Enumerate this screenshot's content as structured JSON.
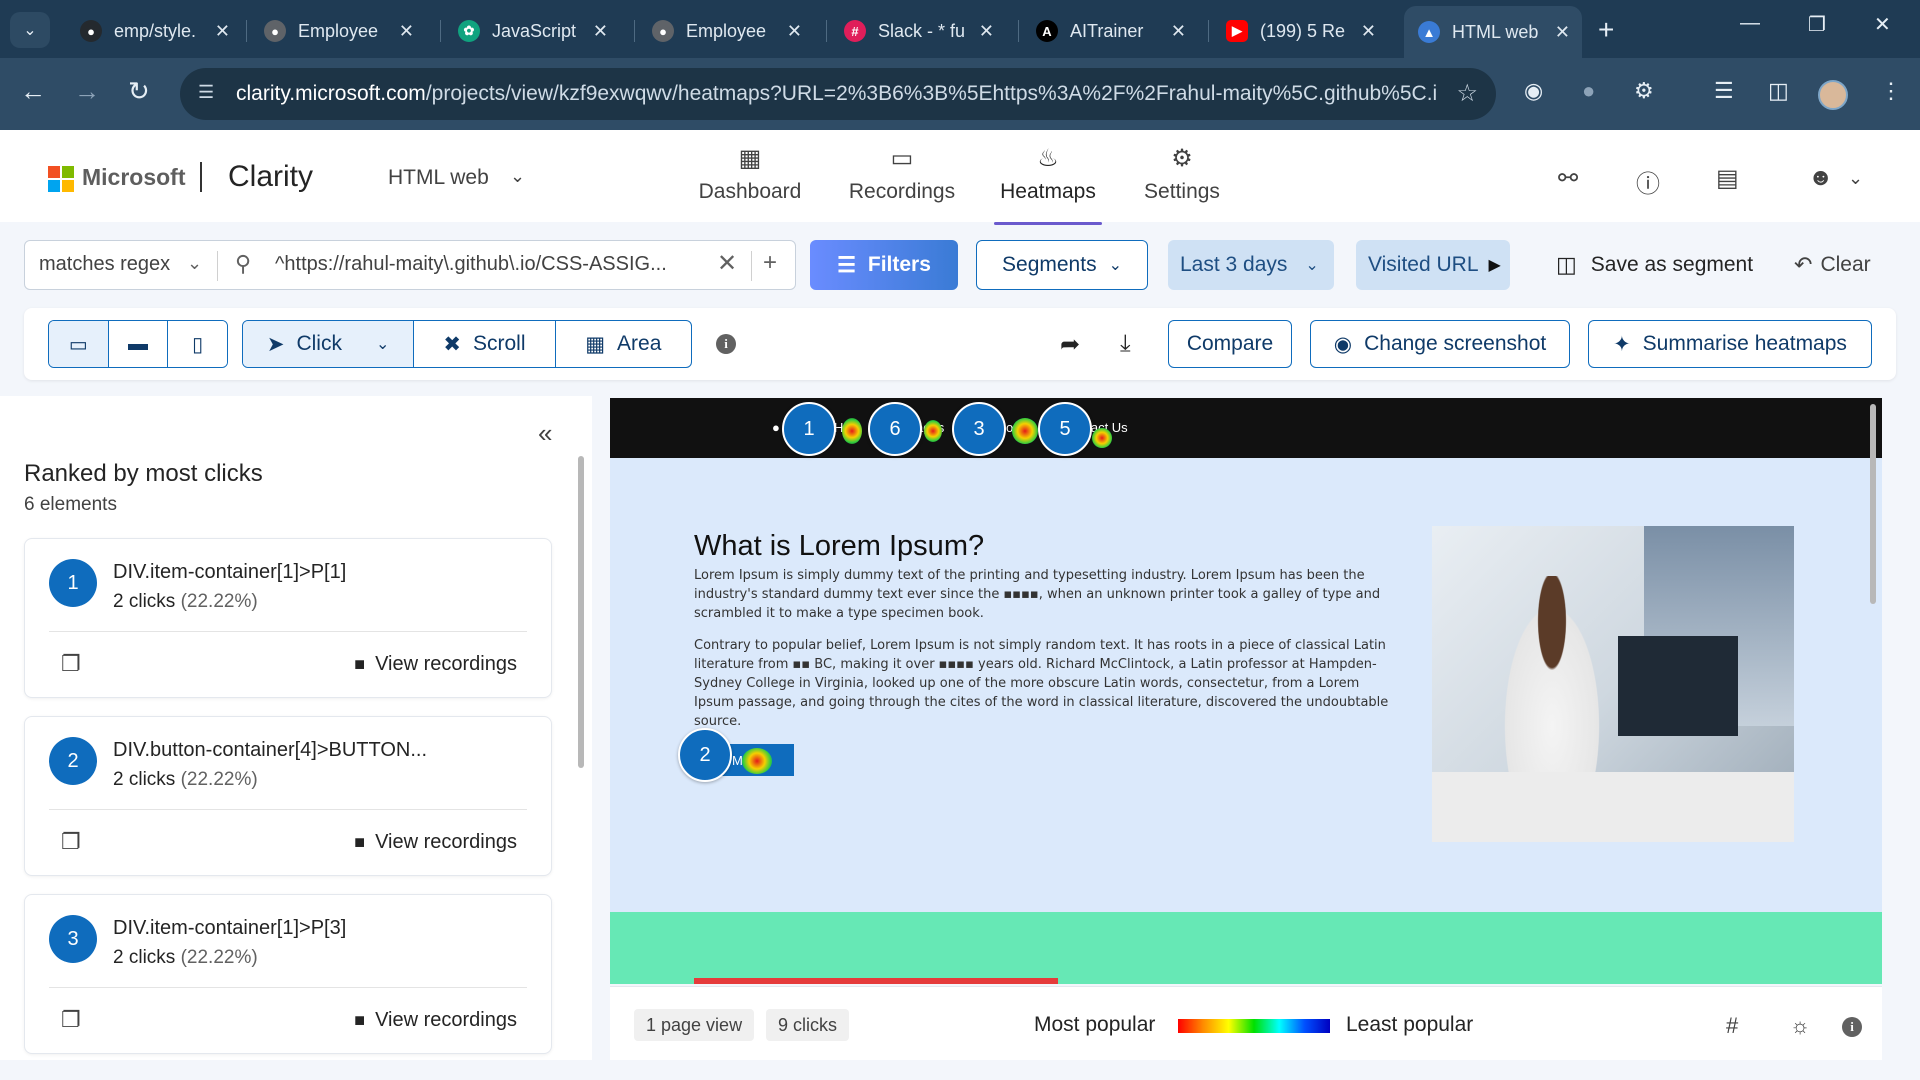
{
  "browser": {
    "tabs": [
      {
        "label": "emp/style.",
        "icon": "github-icon",
        "color": "#24292e"
      },
      {
        "label": "Employee",
        "icon": "globe-icon",
        "color": "#5f6368"
      },
      {
        "label": "JavaScript",
        "icon": "chatgpt-icon",
        "color": "#10a37f"
      },
      {
        "label": "Employee",
        "icon": "globe-icon",
        "color": "#5f6368"
      },
      {
        "label": "Slack - * fu",
        "icon": "slack-icon",
        "color": "#e01e5a"
      },
      {
        "label": "AITrainer",
        "icon": "a-icon",
        "color": "#000000"
      },
      {
        "label": "(199) 5 Re",
        "icon": "youtube-icon",
        "color": "#ff0000"
      },
      {
        "label": "HTML web",
        "icon": "clarity-icon",
        "color": "#3a7bd5"
      }
    ],
    "url_host": "clarity.microsoft.com",
    "url_path": "/projects/view/kzf9exwqwv/heatmaps?URL=2%3B6%3B%5Ehttps%3A%2F%2Frahul-maity%5C.github%5C.i..."
  },
  "header": {
    "ms_text": "Microsoft",
    "brand": "Clarity",
    "project": "HTML web",
    "nav": [
      {
        "label": "Dashboard",
        "icon": "dashboard-icon"
      },
      {
        "label": "Recordings",
        "icon": "video-icon"
      },
      {
        "label": "Heatmaps",
        "icon": "flame-icon"
      },
      {
        "label": "Settings",
        "icon": "gear-icon"
      }
    ],
    "active_nav": "Heatmaps"
  },
  "filters": {
    "operator": "matches regex",
    "value": "^https://rahul-maity\\.github\\.io/CSS-ASSIG...",
    "filters_label": "Filters",
    "segments_label": "Segments",
    "range_label": "Last 3 days",
    "visited_label": "Visited URL",
    "save_label": "Save as segment",
    "clear_label": "Clear"
  },
  "toolbar": {
    "modes": [
      "Click",
      "Scroll",
      "Area"
    ],
    "active_mode": "Click",
    "compare_label": "Compare",
    "change_label": "Change screenshot",
    "summarise_label": "Summarise heatmaps"
  },
  "panel": {
    "title": "Ranked by most clicks",
    "subtitle": "6 elements",
    "view_label": "View recordings",
    "items": [
      {
        "rank": "1",
        "name": "DIV.item-container[1]>P[1]",
        "clicks": "2 clicks",
        "pct": "(22.22%)"
      },
      {
        "rank": "2",
        "name": "DIV.button-container[4]>BUTTON...",
        "clicks": "2 clicks",
        "pct": "(22.22%)"
      },
      {
        "rank": "3",
        "name": "DIV.item-container[1]>P[3]",
        "clicks": "2 clicks",
        "pct": "(22.22%)"
      }
    ]
  },
  "preview": {
    "nav_fragments": [
      "Hom",
      "ages",
      "out",
      "ntact Us"
    ],
    "markers": [
      "1",
      "6",
      "3",
      "5",
      "2"
    ],
    "title": "What is Lorem Ipsum?",
    "para1": "Lorem Ipsum is simply dummy text of the printing and typesetting industry. Lorem Ipsum has been the industry's standard dummy text ever since the ▪▪▪▪, when an unknown printer took a galley of type and scrambled it to make a type specimen book.",
    "para2": "Contrary to popular belief, Lorem Ipsum is not simply random text. It has roots in a piece of classical Latin literature from ▪▪ BC, making it over ▪▪▪▪ years old. Richard McClintock, a Latin professor at Hampden-Sydney College in Virginia, looked up one of the more obscure Latin words, consectetur, from a Lorem Ipsum passage, and going through the cites of the word in classical literature, discovered the undoubtable source.",
    "button_label": "Mo"
  },
  "footer": {
    "page_views": "1 page view",
    "clicks": "9 clicks",
    "most": "Most popular",
    "least": "Least popular"
  }
}
